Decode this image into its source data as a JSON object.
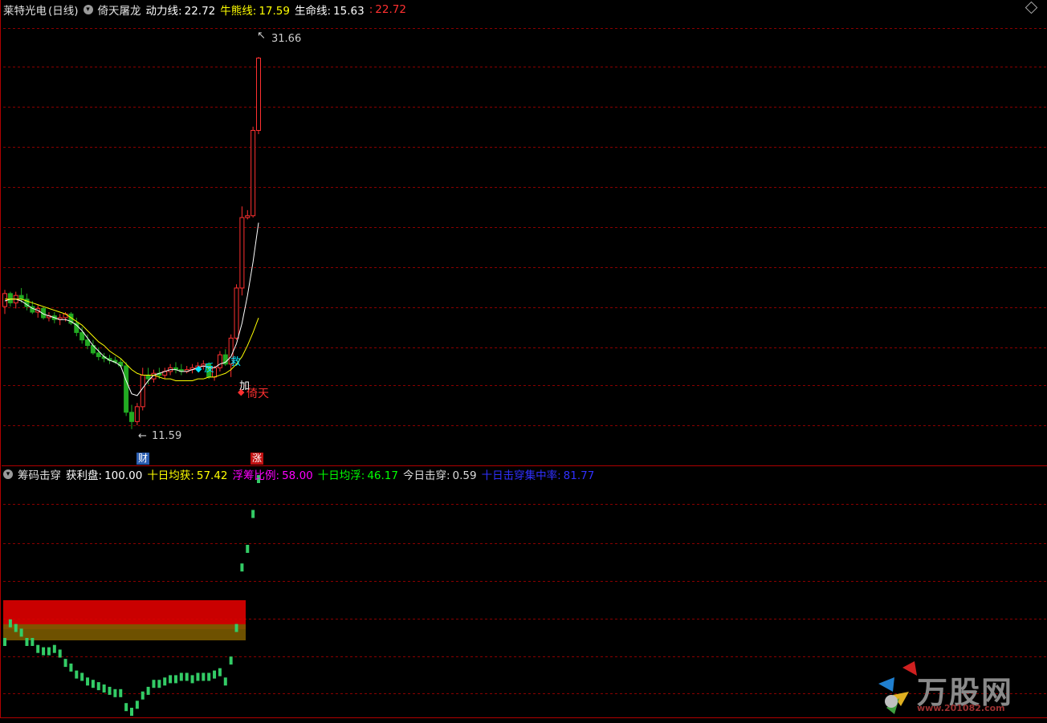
{
  "main_panel": {
    "stock_name": "莱特光电",
    "period": "(日线)",
    "indicator_name": "倚天屠龙",
    "lines": [
      {
        "label": "动力线:",
        "value": "22.72",
        "color": "#ffffff"
      },
      {
        "label": "牛熊线:",
        "value": "17.59",
        "color": "#ffff00"
      },
      {
        "label": "生命线:",
        "value": "15.63",
        "color": "#ffffff"
      },
      {
        "label": ":",
        "value": "22.72",
        "color": "#ff3030"
      }
    ],
    "price_high_label": "31.66",
    "price_low_label": "11.59",
    "markers": {
      "cai": "财",
      "zhang": "涨",
      "jia": "加",
      "yitian": "倚天",
      "fan": "反",
      "jiu": "救"
    }
  },
  "sub_panel": {
    "indicator_name": "筹码击穿",
    "lines": [
      {
        "label": "获利盘:",
        "value": "100.00",
        "color": "#ffffff"
      },
      {
        "label": "十日均获:",
        "value": "57.42",
        "color": "#ffff00"
      },
      {
        "label": "浮筹比例:",
        "value": "58.00",
        "color": "#ff00ff"
      },
      {
        "label": "十日均浮:",
        "value": "46.17",
        "color": "#00ff00"
      },
      {
        "label": "今日击穿:",
        "value": "0.59",
        "color": "#dddddd"
      },
      {
        "label": "十日击穿集中率:",
        "value": "81.77",
        "color": "#3030ff"
      }
    ]
  },
  "watermark": {
    "brand": "万股网",
    "url": "www.201082.com"
  },
  "colors": {
    "up": "#ff3030",
    "down": "#22aa22",
    "grid": "#8a0000",
    "background": "#000000"
  },
  "chart_data": [
    {
      "type": "candlestick",
      "title": "莱特光电 (日线) 倚天屠龙",
      "series": [
        {
          "name": "K",
          "values": [
            [
              18.2,
              19.1,
              17.8,
              18.9
            ],
            [
              18.9,
              19.0,
              18.2,
              18.4
            ],
            [
              18.4,
              19.0,
              18.1,
              18.8
            ],
            [
              18.8,
              19.2,
              18.4,
              18.6
            ],
            [
              18.6,
              18.9,
              18.0,
              18.2
            ],
            [
              18.2,
              18.5,
              17.8,
              17.9
            ],
            [
              17.9,
              18.3,
              17.6,
              18.1
            ],
            [
              18.1,
              18.2,
              17.5,
              17.6
            ],
            [
              17.6,
              17.9,
              17.4,
              17.7
            ],
            [
              17.7,
              17.9,
              17.3,
              17.5
            ],
            [
              17.5,
              17.8,
              17.2,
              17.6
            ],
            [
              17.6,
              17.9,
              17.4,
              17.8
            ],
            [
              17.8,
              17.9,
              17.2,
              17.3
            ],
            [
              17.3,
              17.6,
              16.6,
              16.8
            ],
            [
              16.8,
              17.1,
              16.2,
              16.4
            ],
            [
              16.4,
              16.7,
              15.9,
              16.1
            ],
            [
              16.1,
              16.4,
              15.6,
              15.7
            ],
            [
              15.7,
              16.0,
              15.3,
              15.5
            ],
            [
              15.5,
              15.7,
              15.2,
              15.4
            ],
            [
              15.4,
              15.6,
              15.1,
              15.3
            ],
            [
              15.3,
              15.5,
              15.1,
              15.2
            ],
            [
              15.2,
              15.4,
              14.9,
              15.0
            ],
            [
              15.0,
              15.2,
              12.3,
              12.5
            ],
            [
              12.5,
              12.9,
              11.59,
              12.0
            ],
            [
              12.0,
              13.0,
              11.8,
              12.8
            ],
            [
              12.8,
              14.9,
              12.6,
              14.5
            ],
            [
              14.5,
              14.9,
              14.0,
              14.3
            ],
            [
              14.3,
              14.8,
              14.1,
              14.6
            ],
            [
              14.6,
              14.9,
              14.3,
              14.5
            ],
            [
              14.5,
              14.9,
              14.3,
              14.7
            ],
            [
              14.7,
              15.1,
              14.5,
              14.9
            ],
            [
              14.9,
              15.2,
              14.6,
              14.8
            ],
            [
              14.8,
              15.1,
              14.5,
              14.7
            ],
            [
              14.7,
              15.0,
              14.6,
              14.8
            ],
            [
              14.8,
              15.1,
              14.6,
              14.9
            ],
            [
              14.9,
              15.2,
              14.7,
              15.0
            ],
            [
              15.0,
              15.3,
              14.8,
              15.1
            ],
            [
              15.1,
              15.2,
              14.3,
              14.4
            ],
            [
              14.4,
              15.0,
              14.2,
              14.9
            ],
            [
              14.9,
              15.8,
              14.7,
              15.6
            ],
            [
              15.6,
              15.9,
              15.0,
              15.1
            ],
            [
              15.1,
              16.7,
              14.4,
              16.5
            ],
            [
              16.5,
              19.4,
              16.4,
              19.2
            ],
            [
              19.2,
              23.6,
              18.8,
              23.0
            ],
            [
              23.0,
              23.4,
              22.9,
              23.1
            ],
            [
              23.1,
              27.9,
              23.0,
              27.7
            ],
            [
              27.7,
              31.66,
              27.5,
              31.6
            ]
          ]
        },
        {
          "name": "动力线",
          "values": [
            18.5,
            18.6,
            18.6,
            18.5,
            18.3,
            18.1,
            18.0,
            17.8,
            17.7,
            17.6,
            17.5,
            17.5,
            17.4,
            17.2,
            16.9,
            16.5,
            16.1,
            15.8,
            15.5,
            15.3,
            15.2,
            15.0,
            14.2,
            13.5,
            13.4,
            13.8,
            14.2,
            14.5,
            14.6,
            14.7,
            14.8,
            14.8,
            14.7,
            14.7,
            14.8,
            14.9,
            15.0,
            14.9,
            14.9,
            15.1,
            15.2,
            15.5,
            16.2,
            17.3,
            18.8,
            20.6,
            22.72
          ]
        },
        {
          "name": "牛熊线",
          "values": [
            18.6,
            18.6,
            18.6,
            18.6,
            18.5,
            18.4,
            18.3,
            18.2,
            18.1,
            18.0,
            17.9,
            17.8,
            17.6,
            17.4,
            17.2,
            16.9,
            16.6,
            16.3,
            16.1,
            15.8,
            15.6,
            15.4,
            15.1,
            14.8,
            14.6,
            14.5,
            14.5,
            14.5,
            14.4,
            14.3,
            14.3,
            14.2,
            14.2,
            14.2,
            14.2,
            14.3,
            14.3,
            14.4,
            14.4,
            14.5,
            14.6,
            14.8,
            15.1,
            15.5,
            16.1,
            16.8,
            17.59
          ]
        }
      ],
      "ylim": [
        10.5,
        33.0
      ]
    },
    {
      "type": "bar",
      "title": "筹码击穿",
      "series": [
        {
          "name": "获利盘",
          "values": [
            30,
            38,
            36,
            34,
            30,
            30,
            27,
            26,
            26,
            27,
            25,
            21,
            19,
            16,
            15,
            13,
            12,
            11,
            10,
            9,
            8,
            8,
            2,
            0,
            3,
            7,
            9,
            12,
            12,
            13,
            14,
            14,
            15,
            15,
            14,
            15,
            15,
            15,
            16,
            17,
            13,
            22,
            36,
            62,
            70,
            85,
            100
          ]
        }
      ],
      "ylim": [
        0,
        100
      ]
    }
  ]
}
